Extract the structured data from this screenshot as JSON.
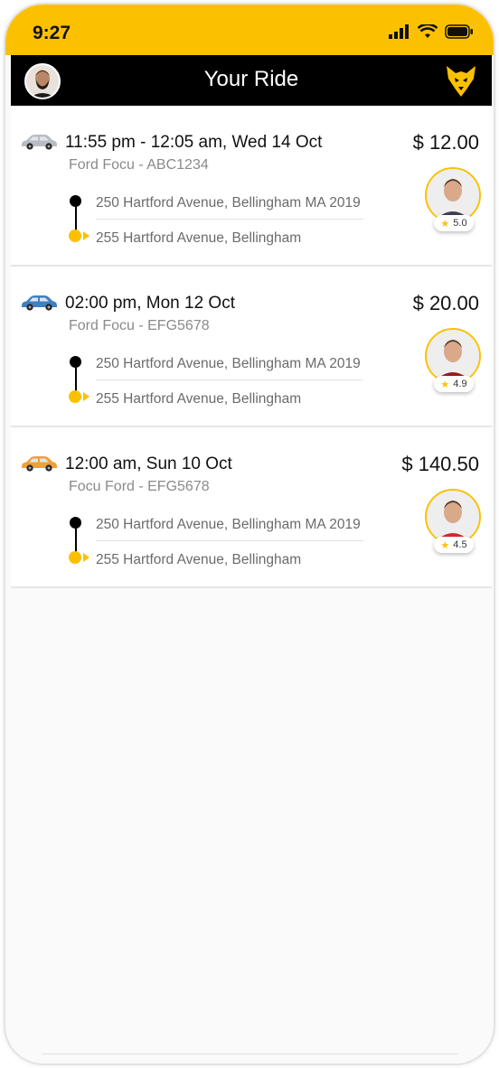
{
  "status_bar": {
    "time": "9:27"
  },
  "app_bar": {
    "title": "Your Ride"
  },
  "colors": {
    "accent": "#fbc100",
    "app_bar": "#000000"
  },
  "rides": [
    {
      "car_color": "#b9bcc2",
      "when": "11:55 pm - 12:05 am, Wed 14 Oct",
      "vehicle": "Ford Focu - ABC1234",
      "price": "$ 12.00",
      "from": "250 Hartford Avenue, Bellingham MA 2019",
      "to": "255 Hartford Avenue, Bellingham",
      "rating": "5.0",
      "driver_shirt": "#3d4250"
    },
    {
      "car_color": "#3f7fc4",
      "when": "02:00 pm, Mon 12 Oct",
      "vehicle": "Ford Focu - EFG5678",
      "price": "$ 20.00",
      "from": "250 Hartford Avenue, Bellingham MA 2019",
      "to": "255 Hartford Avenue, Bellingham",
      "rating": "4.9",
      "driver_shirt": "#9a1b22"
    },
    {
      "car_color": "#f0a036",
      "when": "12:00 am, Sun 10 Oct",
      "vehicle": "Focu Ford - EFG5678",
      "price": "$ 140.50",
      "from": "250 Hartford Avenue, Bellingham MA 2019",
      "to": "255 Hartford Avenue, Bellingham",
      "rating": "4.5",
      "driver_shirt": "#d8262c"
    }
  ]
}
